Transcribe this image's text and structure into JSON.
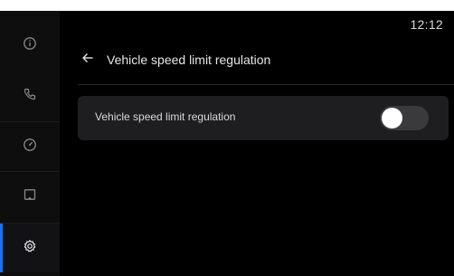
{
  "status_bar": {
    "time": "12:12"
  },
  "rail": {
    "items": [
      {
        "icon": "info-icon",
        "active": false
      },
      {
        "icon": "phone-icon",
        "active": false
      },
      {
        "icon": "speedometer-icon",
        "active": false
      },
      {
        "icon": "screen-icon",
        "active": false
      },
      {
        "icon": "gear-icon",
        "active": true
      }
    ]
  },
  "header": {
    "back_icon": "arrow-left-icon",
    "title": "Vehicle speed limit regulation"
  },
  "settings": {
    "rows": [
      {
        "label": "Vehicle speed limit regulation",
        "control": "toggle",
        "enabled": false
      }
    ]
  },
  "colors": {
    "background": "#000000",
    "rail_background": "#0e0e0f",
    "row_background": "#1e1e20",
    "accent": "#1a73e8",
    "toggle_track_off": "#3a3a3c",
    "text_primary": "#e6e6e6"
  }
}
